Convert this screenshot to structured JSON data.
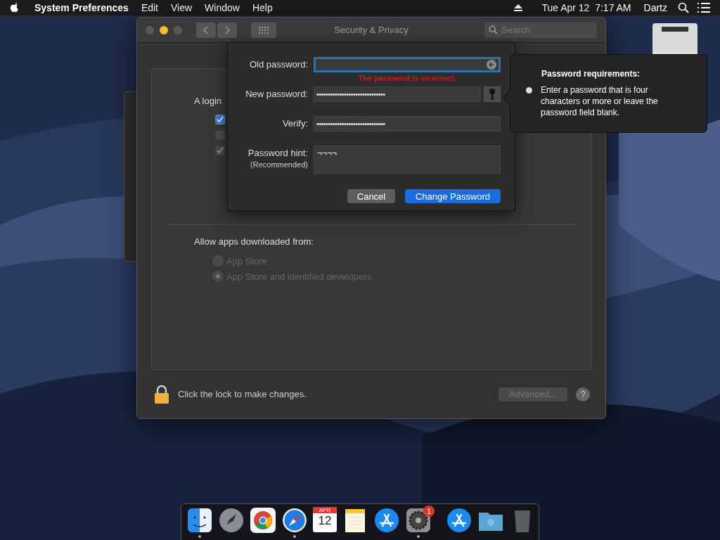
{
  "menu_bar": {
    "app_name": "System Preferences",
    "menus": [
      "Edit",
      "View",
      "Window",
      "Help"
    ],
    "clock": "Tue Apr 12  7:17 AM",
    "user": "Dartz"
  },
  "window": {
    "title": "Security & Privacy",
    "search": {
      "placeholder": "Search"
    },
    "login_section": {
      "label": "A login",
      "checkboxes": [
        {
          "checked": true,
          "disabled": false
        },
        {
          "checked": false,
          "disabled": true
        },
        {
          "checked": true,
          "disabled": true
        }
      ]
    },
    "downloads": {
      "label": "Allow apps downloaded from:",
      "options": [
        {
          "label": "App Store",
          "selected": false,
          "disabled": true
        },
        {
          "label": "App Store and identified developers",
          "selected": true,
          "disabled": true
        }
      ]
    },
    "lock_text": "Click the lock to make changes.",
    "help_button": "?",
    "advanced_button": {
      "label": "Advanced...",
      "disabled": true
    }
  },
  "sheet": {
    "fields": [
      {
        "kind": "password",
        "label": "Old password:",
        "focused": true,
        "error": "The password is incorrect."
      },
      {
        "kind": "password",
        "label": "New password:",
        "value": "••••••••••••••••••••••••••••••",
        "focused": false,
        "key_button": true
      },
      {
        "kind": "password",
        "label": "Verify:",
        "value": "••••••••••••••••••••••••••••••",
        "focused": false
      },
      {
        "kind": "hint",
        "label": "Password hint:",
        "sublabel": "(Recommended)",
        "value": "¬¬¬¬",
        "focused": false
      }
    ],
    "buttons": [
      {
        "label": "Cancel",
        "primary": false
      },
      {
        "label": "Change Password",
        "primary": true
      }
    ]
  },
  "popover": {
    "title": "Password requirements:",
    "items": [
      "Enter a password that is four characters or more or leave the password field blank."
    ]
  },
  "dock": {
    "items": [
      {
        "kind": "finder",
        "running": true
      },
      {
        "kind": "launchpad",
        "running": false
      },
      {
        "kind": "chrome",
        "running": false
      },
      {
        "kind": "safari",
        "running": true
      },
      {
        "kind": "calendar",
        "running": false,
        "month": "APR",
        "day": "12"
      },
      {
        "kind": "notes",
        "running": false
      },
      {
        "kind": "appstore",
        "running": false
      },
      {
        "kind": "settings",
        "running": true,
        "badge": "1"
      },
      {
        "kind": "separator"
      },
      {
        "kind": "appstore",
        "running": false
      },
      {
        "kind": "folder",
        "running": false
      },
      {
        "kind": "trash",
        "running": false
      }
    ]
  }
}
